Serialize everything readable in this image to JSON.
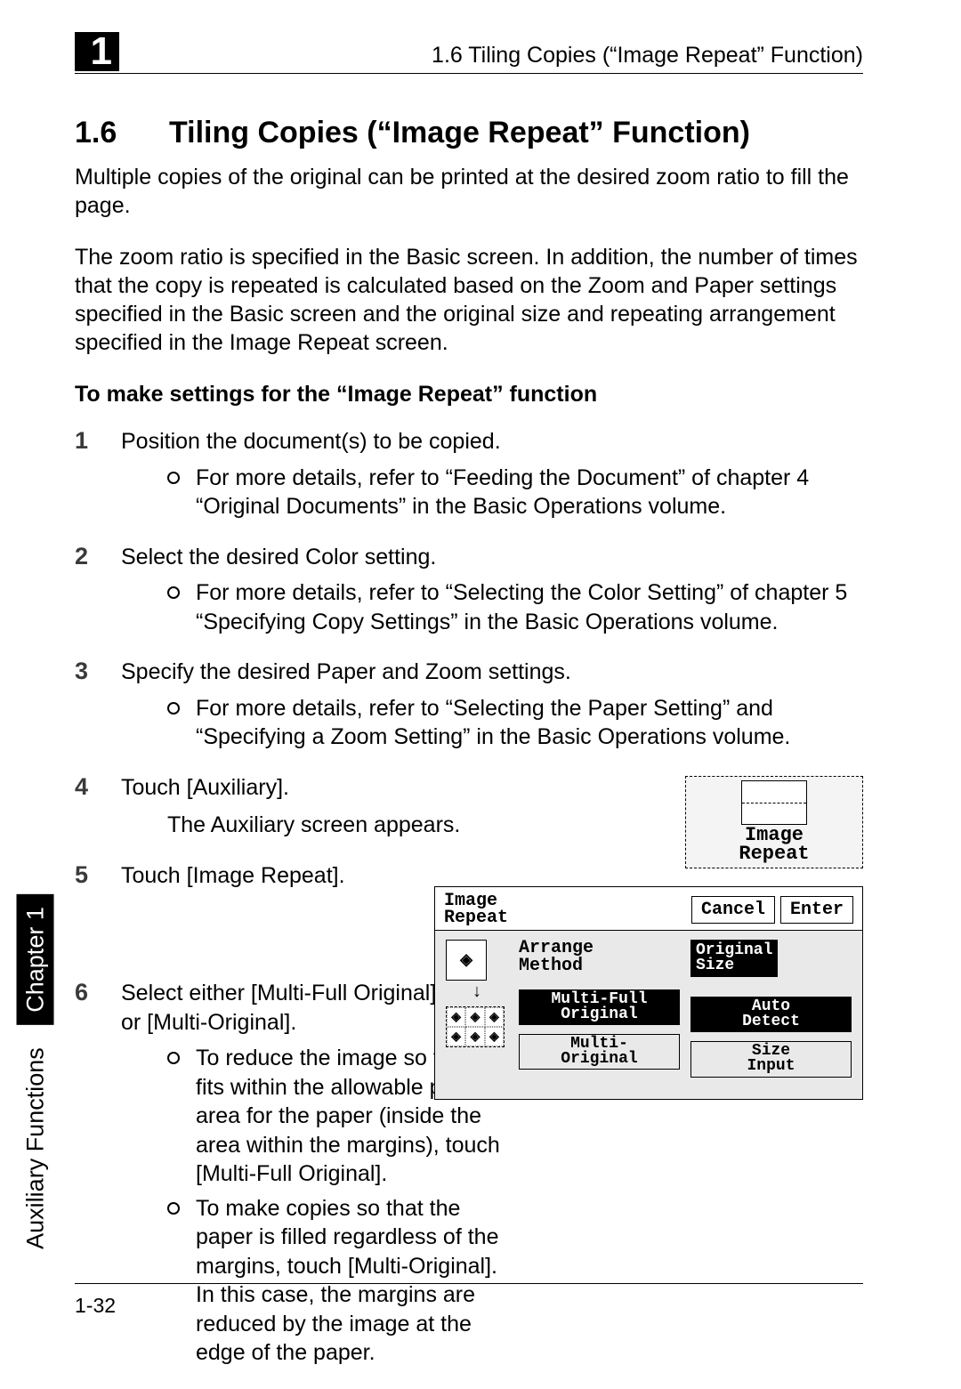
{
  "header": {
    "chapter_tab": "1",
    "running": "1.6 Tiling Copies (“Image Repeat” Function)"
  },
  "side": {
    "aux": "Auxiliary Functions",
    "chapter": "Chapter 1"
  },
  "section": {
    "num": "1.6",
    "title": "Tiling Copies (“Image Repeat” Function)"
  },
  "intro": [
    "Multiple copies of the original can be printed at the desired zoom ratio to fill the page.",
    "The zoom ratio is specified in the Basic screen. In addition, the number of times that the copy is repeated is calculated based on the Zoom and Paper settings specified in the Basic screen and the original size and repeating arrangement specified in the Image Repeat screen."
  ],
  "subhead": "To make settings for the “Image Repeat” function",
  "steps": [
    {
      "text": "Position the document(s) to be copied.",
      "bullets": [
        "For more details, refer to “Feeding the Document” of chapter 4 “Original Documents” in the Basic Operations volume."
      ]
    },
    {
      "text": "Select the desired Color setting.",
      "bullets": [
        "For more details, refer to “Selecting the Color Setting” of chapter 5 “Specifying Copy Settings” in the Basic Operations volume."
      ]
    },
    {
      "text": "Specify the desired Paper and Zoom settings.",
      "bullets": [
        "For more details, refer to “Selecting the Paper Setting” and “Specifying a Zoom Setting” in the Basic Operations volume."
      ]
    },
    {
      "text": "Touch [Auxiliary].",
      "after": "The Auxiliary screen appears."
    },
    {
      "text": "Touch [Image Repeat]."
    },
    {
      "text": "Select either [Multi-Full Original] or [Multi-Original].",
      "bullets": [
        "To reduce the image so that it fits within the allowable print area for the paper (inside the area within the margins), touch [Multi-Full Original].",
        "To make copies so that the paper is filled regardless of the margins, touch [Multi-Original]. In this case, the margins are reduced by the image at the edge of the paper."
      ]
    }
  ],
  "fig1": {
    "label": "Image\nRepeat"
  },
  "fig2": {
    "title": "Image\nRepeat",
    "cancel": "Cancel",
    "enter": "Enter",
    "arrange": "Arrange\nMethod",
    "multi_full": "Multi-Full\nOriginal",
    "multi_orig": "Multi-\nOriginal",
    "orig_size": "Original\nSize",
    "auto": "Auto\nDetect",
    "size_input": "Size\nInput"
  },
  "footer": {
    "page": "1-32"
  }
}
